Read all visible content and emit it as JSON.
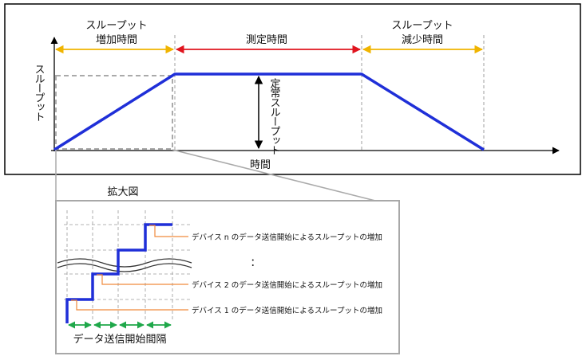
{
  "phases": {
    "ramp_up": [
      "スループット",
      "増加時間"
    ],
    "measure": "測定時間",
    "ramp_down": [
      "スループット",
      "減少時間"
    ]
  },
  "axes": {
    "y_label": "スループット",
    "x_label": "時間",
    "constant_label": "定常スループット"
  },
  "zoom": {
    "title": "拡大図",
    "annotations": [
      "デバイス n のデータ送信開始によるスループットの増加",
      "デバイス 2 のデータ送信開始によるスループットの増加",
      "デバイス 1 のデータ送信開始によるスループットの増加"
    ],
    "ellipsis": "：",
    "interval_label": "データ送信開始間隔"
  },
  "colors": {
    "throughput_line": "#1f2fd8",
    "phase_arrow_yellow": "#f0b400",
    "phase_arrow_red": "#e0141e",
    "annotation_orange": "#f08a3c",
    "interval_green": "#1fa84a",
    "zoom_outline": "#a8a8a8"
  }
}
